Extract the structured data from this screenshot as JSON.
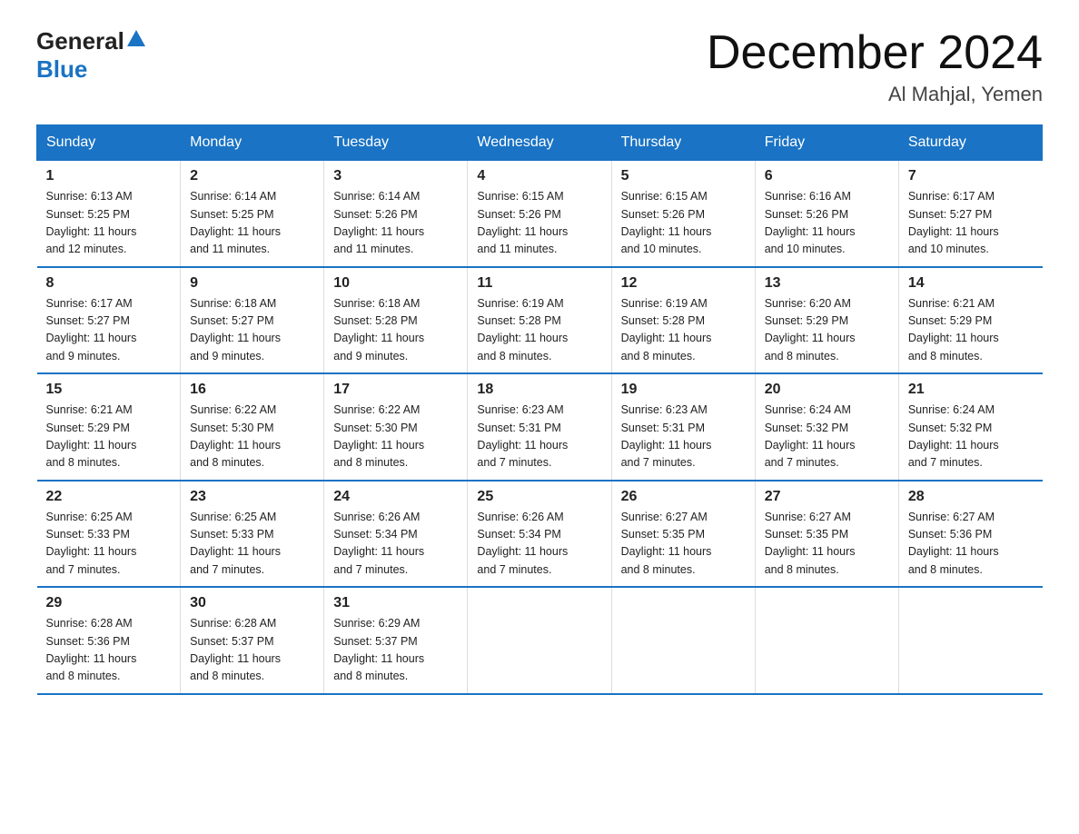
{
  "header": {
    "logo_general": "General",
    "logo_blue": "Blue",
    "month_title": "December 2024",
    "location": "Al Mahjal, Yemen"
  },
  "days_of_week": [
    "Sunday",
    "Monday",
    "Tuesday",
    "Wednesday",
    "Thursday",
    "Friday",
    "Saturday"
  ],
  "weeks": [
    [
      {
        "day": "1",
        "sunrise": "6:13 AM",
        "sunset": "5:25 PM",
        "daylight": "11 hours and 12 minutes."
      },
      {
        "day": "2",
        "sunrise": "6:14 AM",
        "sunset": "5:25 PM",
        "daylight": "11 hours and 11 minutes."
      },
      {
        "day": "3",
        "sunrise": "6:14 AM",
        "sunset": "5:26 PM",
        "daylight": "11 hours and 11 minutes."
      },
      {
        "day": "4",
        "sunrise": "6:15 AM",
        "sunset": "5:26 PM",
        "daylight": "11 hours and 11 minutes."
      },
      {
        "day": "5",
        "sunrise": "6:15 AM",
        "sunset": "5:26 PM",
        "daylight": "11 hours and 10 minutes."
      },
      {
        "day": "6",
        "sunrise": "6:16 AM",
        "sunset": "5:26 PM",
        "daylight": "11 hours and 10 minutes."
      },
      {
        "day": "7",
        "sunrise": "6:17 AM",
        "sunset": "5:27 PM",
        "daylight": "11 hours and 10 minutes."
      }
    ],
    [
      {
        "day": "8",
        "sunrise": "6:17 AM",
        "sunset": "5:27 PM",
        "daylight": "11 hours and 9 minutes."
      },
      {
        "day": "9",
        "sunrise": "6:18 AM",
        "sunset": "5:27 PM",
        "daylight": "11 hours and 9 minutes."
      },
      {
        "day": "10",
        "sunrise": "6:18 AM",
        "sunset": "5:28 PM",
        "daylight": "11 hours and 9 minutes."
      },
      {
        "day": "11",
        "sunrise": "6:19 AM",
        "sunset": "5:28 PM",
        "daylight": "11 hours and 8 minutes."
      },
      {
        "day": "12",
        "sunrise": "6:19 AM",
        "sunset": "5:28 PM",
        "daylight": "11 hours and 8 minutes."
      },
      {
        "day": "13",
        "sunrise": "6:20 AM",
        "sunset": "5:29 PM",
        "daylight": "11 hours and 8 minutes."
      },
      {
        "day": "14",
        "sunrise": "6:21 AM",
        "sunset": "5:29 PM",
        "daylight": "11 hours and 8 minutes."
      }
    ],
    [
      {
        "day": "15",
        "sunrise": "6:21 AM",
        "sunset": "5:29 PM",
        "daylight": "11 hours and 8 minutes."
      },
      {
        "day": "16",
        "sunrise": "6:22 AM",
        "sunset": "5:30 PM",
        "daylight": "11 hours and 8 minutes."
      },
      {
        "day": "17",
        "sunrise": "6:22 AM",
        "sunset": "5:30 PM",
        "daylight": "11 hours and 8 minutes."
      },
      {
        "day": "18",
        "sunrise": "6:23 AM",
        "sunset": "5:31 PM",
        "daylight": "11 hours and 7 minutes."
      },
      {
        "day": "19",
        "sunrise": "6:23 AM",
        "sunset": "5:31 PM",
        "daylight": "11 hours and 7 minutes."
      },
      {
        "day": "20",
        "sunrise": "6:24 AM",
        "sunset": "5:32 PM",
        "daylight": "11 hours and 7 minutes."
      },
      {
        "day": "21",
        "sunrise": "6:24 AM",
        "sunset": "5:32 PM",
        "daylight": "11 hours and 7 minutes."
      }
    ],
    [
      {
        "day": "22",
        "sunrise": "6:25 AM",
        "sunset": "5:33 PM",
        "daylight": "11 hours and 7 minutes."
      },
      {
        "day": "23",
        "sunrise": "6:25 AM",
        "sunset": "5:33 PM",
        "daylight": "11 hours and 7 minutes."
      },
      {
        "day": "24",
        "sunrise": "6:26 AM",
        "sunset": "5:34 PM",
        "daylight": "11 hours and 7 minutes."
      },
      {
        "day": "25",
        "sunrise": "6:26 AM",
        "sunset": "5:34 PM",
        "daylight": "11 hours and 7 minutes."
      },
      {
        "day": "26",
        "sunrise": "6:27 AM",
        "sunset": "5:35 PM",
        "daylight": "11 hours and 8 minutes."
      },
      {
        "day": "27",
        "sunrise": "6:27 AM",
        "sunset": "5:35 PM",
        "daylight": "11 hours and 8 minutes."
      },
      {
        "day": "28",
        "sunrise": "6:27 AM",
        "sunset": "5:36 PM",
        "daylight": "11 hours and 8 minutes."
      }
    ],
    [
      {
        "day": "29",
        "sunrise": "6:28 AM",
        "sunset": "5:36 PM",
        "daylight": "11 hours and 8 minutes."
      },
      {
        "day": "30",
        "sunrise": "6:28 AM",
        "sunset": "5:37 PM",
        "daylight": "11 hours and 8 minutes."
      },
      {
        "day": "31",
        "sunrise": "6:29 AM",
        "sunset": "5:37 PM",
        "daylight": "11 hours and 8 minutes."
      },
      null,
      null,
      null,
      null
    ]
  ],
  "labels": {
    "sunrise": "Sunrise:",
    "sunset": "Sunset:",
    "daylight": "Daylight:"
  }
}
